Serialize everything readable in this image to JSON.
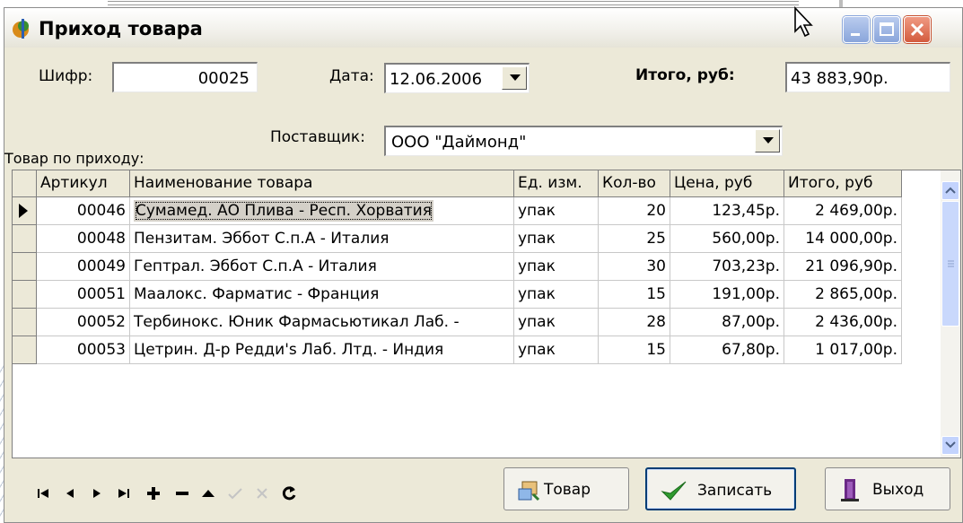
{
  "window": {
    "title": "Приход товара"
  },
  "form": {
    "code_label": "Шифр:",
    "code_value": "00025",
    "date_label": "Дата:",
    "date_value": "12.06.2006",
    "total_label": "Итого, руб:",
    "total_value": "43 883,90р.",
    "supplier_label": "Поставщик:",
    "supplier_value": "ООО \"Даймонд\"",
    "goods_label": "Товар по приходу:"
  },
  "grid": {
    "columns": [
      "Артикул",
      "Наименование товара",
      "Ед. изм.",
      "Кол-во",
      "Цена, руб",
      "Итого, руб"
    ],
    "rows": [
      [
        "00046",
        "Сумамед. АО Плива - Респ. Хорватия",
        "упак",
        "20",
        "123,45р.",
        "2 469,00р."
      ],
      [
        "00048",
        "Пензитам. Эббот С.п.А - Италия",
        "упак",
        "25",
        "560,00р.",
        "14 000,00р."
      ],
      [
        "00049",
        "Гептрал. Эббот С.п.А - Италия",
        "упак",
        "30",
        "703,23р.",
        "21 096,90р."
      ],
      [
        "00051",
        "Маалокс. Фарматис - Франция",
        "упак",
        "15",
        "191,00р.",
        "2 865,00р."
      ],
      [
        "00052",
        "Тербинокс. Юник Фармасьютикал Лаб. -",
        "упак",
        "28",
        "87,00р.",
        "2 436,00р."
      ],
      [
        "00053",
        "Цетрин. Д-р Редди's Лаб. Лтд. - Индия",
        "упак",
        "15",
        "67,80р.",
        "1 017,00р."
      ]
    ]
  },
  "buttons": {
    "goods": "Товар",
    "save": "Записать",
    "exit": "Выход"
  },
  "navigator": [
    "first-icon",
    "prior-icon",
    "next-icon",
    "last-icon",
    "insert-icon",
    "delete-icon",
    "edit-icon",
    "post-icon",
    "cancel-icon",
    "refresh-icon"
  ],
  "colors": {
    "titlebar_close": "#d35b3e",
    "titlebar_button": "#8aa6db",
    "save_check": "#2f9b2f",
    "window_bg": "#ece9d8"
  }
}
